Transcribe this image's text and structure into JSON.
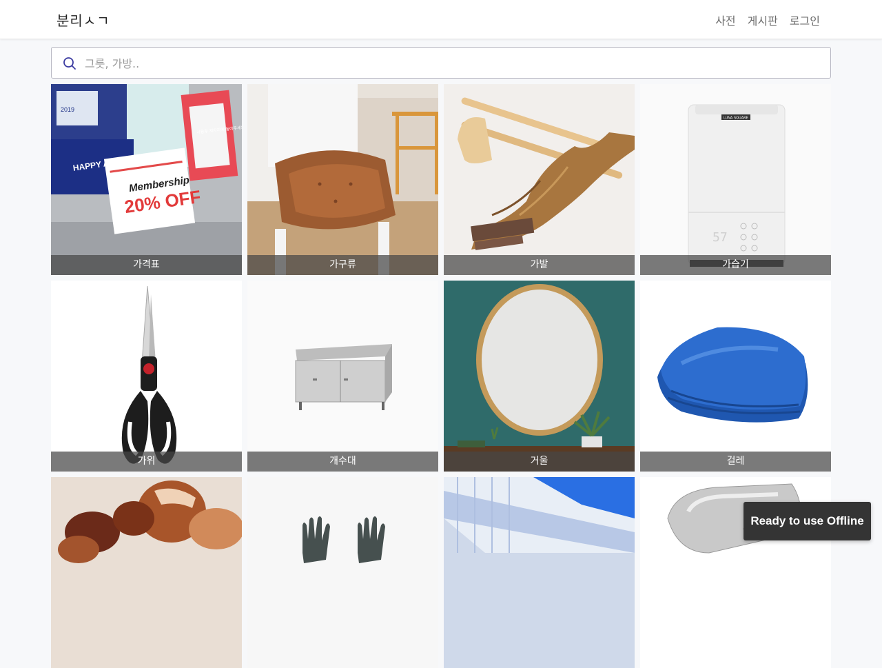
{
  "app": {
    "brand": "분리ㅅㄱ"
  },
  "nav": {
    "items": [
      "사전",
      "게시판",
      "로그인"
    ]
  },
  "search": {
    "placeholder": "그릇, 가방..",
    "value": ""
  },
  "tiles": [
    {
      "label": "가격표",
      "image_text": [
        "Membership",
        "20% OFF",
        "HAPPY ANNIVERSARY",
        "사용후 제자리에 놓아주세요",
        "2019"
      ]
    },
    {
      "label": "가구류"
    },
    {
      "label": "가발"
    },
    {
      "label": "가습기",
      "image_text": [
        "LUNA SQUARE",
        "57"
      ]
    },
    {
      "label": "가위"
    },
    {
      "label": "개수대"
    },
    {
      "label": "거울"
    },
    {
      "label": "걸레"
    },
    {
      "label": ""
    },
    {
      "label": ""
    },
    {
      "label": ""
    },
    {
      "label": ""
    }
  ],
  "toast": {
    "text": "Ready to use Offline"
  },
  "colors": {
    "caption_bg": "#464646",
    "toast_bg": "#343434",
    "search_icon": "#3a3aa0"
  }
}
